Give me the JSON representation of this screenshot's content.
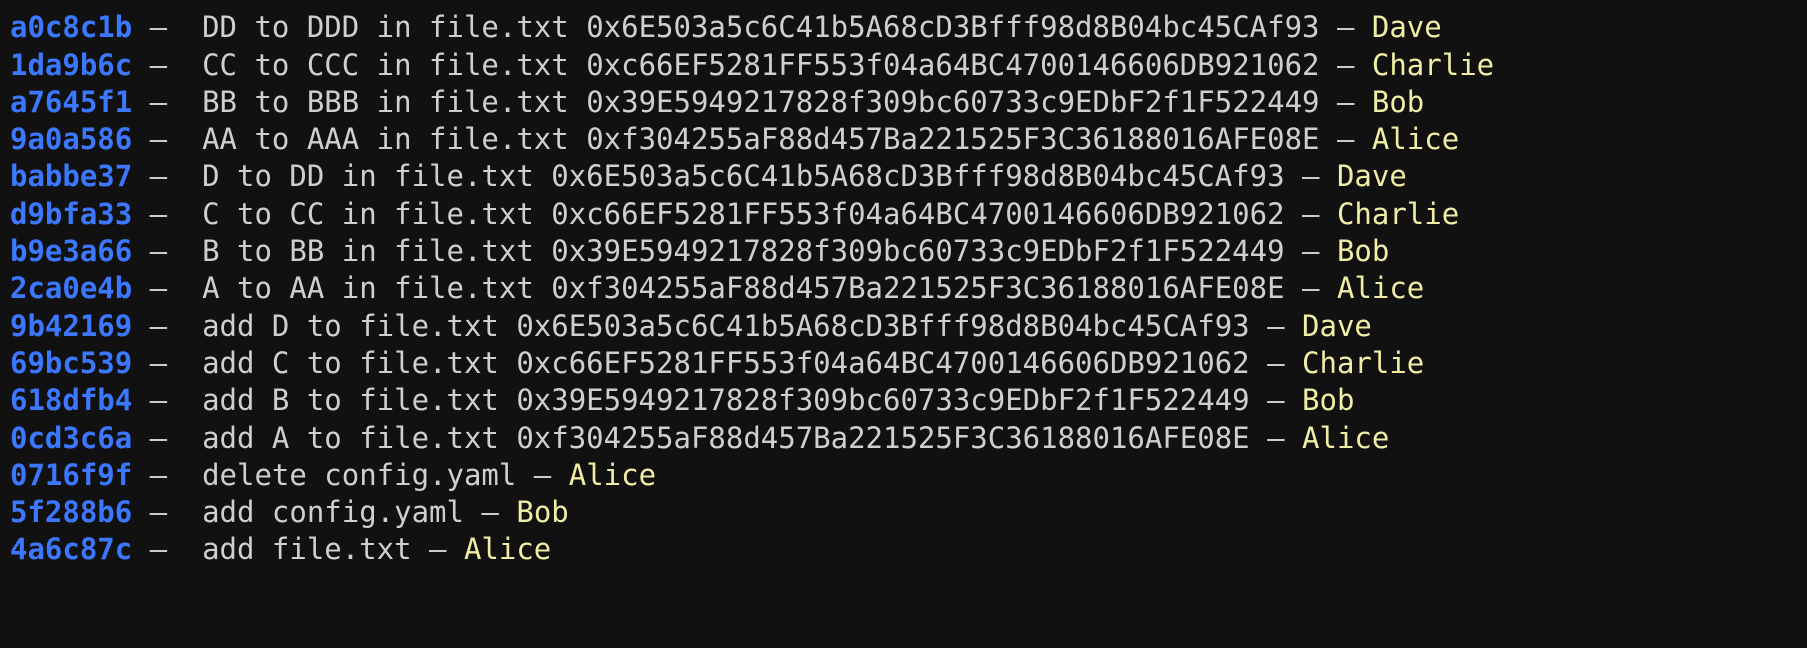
{
  "terminal": {
    "title": "git log --oneline",
    "background_color": "#111111",
    "hash_color": "#3b78ff",
    "message_color": "#cfcfcf",
    "author_color": "#f0eda4",
    "separator": "–",
    "scrolled_partial_line_above": true
  },
  "commits": [
    {
      "hash": "a0c8c1b",
      "message": "DD to DDD in file.txt",
      "address": "0x6E503a5c6C41b5A68cD3Bfff98d8B04bc45CAf93",
      "author": "Dave"
    },
    {
      "hash": "1da9b6c",
      "message": "CC to CCC in file.txt",
      "address": "0xc66EF5281FF553f04a64BC4700146606DB921062",
      "author": "Charlie"
    },
    {
      "hash": "a7645f1",
      "message": "BB to BBB in file.txt",
      "address": "0x39E5949217828f309bc60733c9EDbF2f1F522449",
      "author": "Bob"
    },
    {
      "hash": "9a0a586",
      "message": "AA to AAA in file.txt",
      "address": "0xf304255aF88d457Ba221525F3C36188016AFE08E",
      "author": "Alice"
    },
    {
      "hash": "babbe37",
      "message": "D to DD in file.txt",
      "address": "0x6E503a5c6C41b5A68cD3Bfff98d8B04bc45CAf93",
      "author": "Dave"
    },
    {
      "hash": "d9bfa33",
      "message": "C to CC in file.txt",
      "address": "0xc66EF5281FF553f04a64BC4700146606DB921062",
      "author": "Charlie"
    },
    {
      "hash": "b9e3a66",
      "message": "B to BB in file.txt",
      "address": "0x39E5949217828f309bc60733c9EDbF2f1F522449",
      "author": "Bob"
    },
    {
      "hash": "2ca0e4b",
      "message": "A to AA in file.txt",
      "address": "0xf304255aF88d457Ba221525F3C36188016AFE08E",
      "author": "Alice"
    },
    {
      "hash": "9b42169",
      "message": "add D to file.txt",
      "address": "0x6E503a5c6C41b5A68cD3Bfff98d8B04bc45CAf93",
      "author": "Dave"
    },
    {
      "hash": "69bc539",
      "message": "add C to file.txt",
      "address": "0xc66EF5281FF553f04a64BC4700146606DB921062",
      "author": "Charlie"
    },
    {
      "hash": "618dfb4",
      "message": "add B to file.txt",
      "address": "0x39E5949217828f309bc60733c9EDbF2f1F522449",
      "author": "Bob"
    },
    {
      "hash": "0cd3c6a",
      "message": "add A to file.txt",
      "address": "0xf304255aF88d457Ba221525F3C36188016AFE08E",
      "author": "Alice"
    },
    {
      "hash": "0716f9f",
      "message": "delete config.yaml",
      "address": "",
      "author": "Alice"
    },
    {
      "hash": "5f288b6",
      "message": "add config.yaml",
      "address": "",
      "author": "Bob"
    },
    {
      "hash": "4a6c87c",
      "message": "add file.txt",
      "address": "",
      "author": "Alice"
    }
  ]
}
